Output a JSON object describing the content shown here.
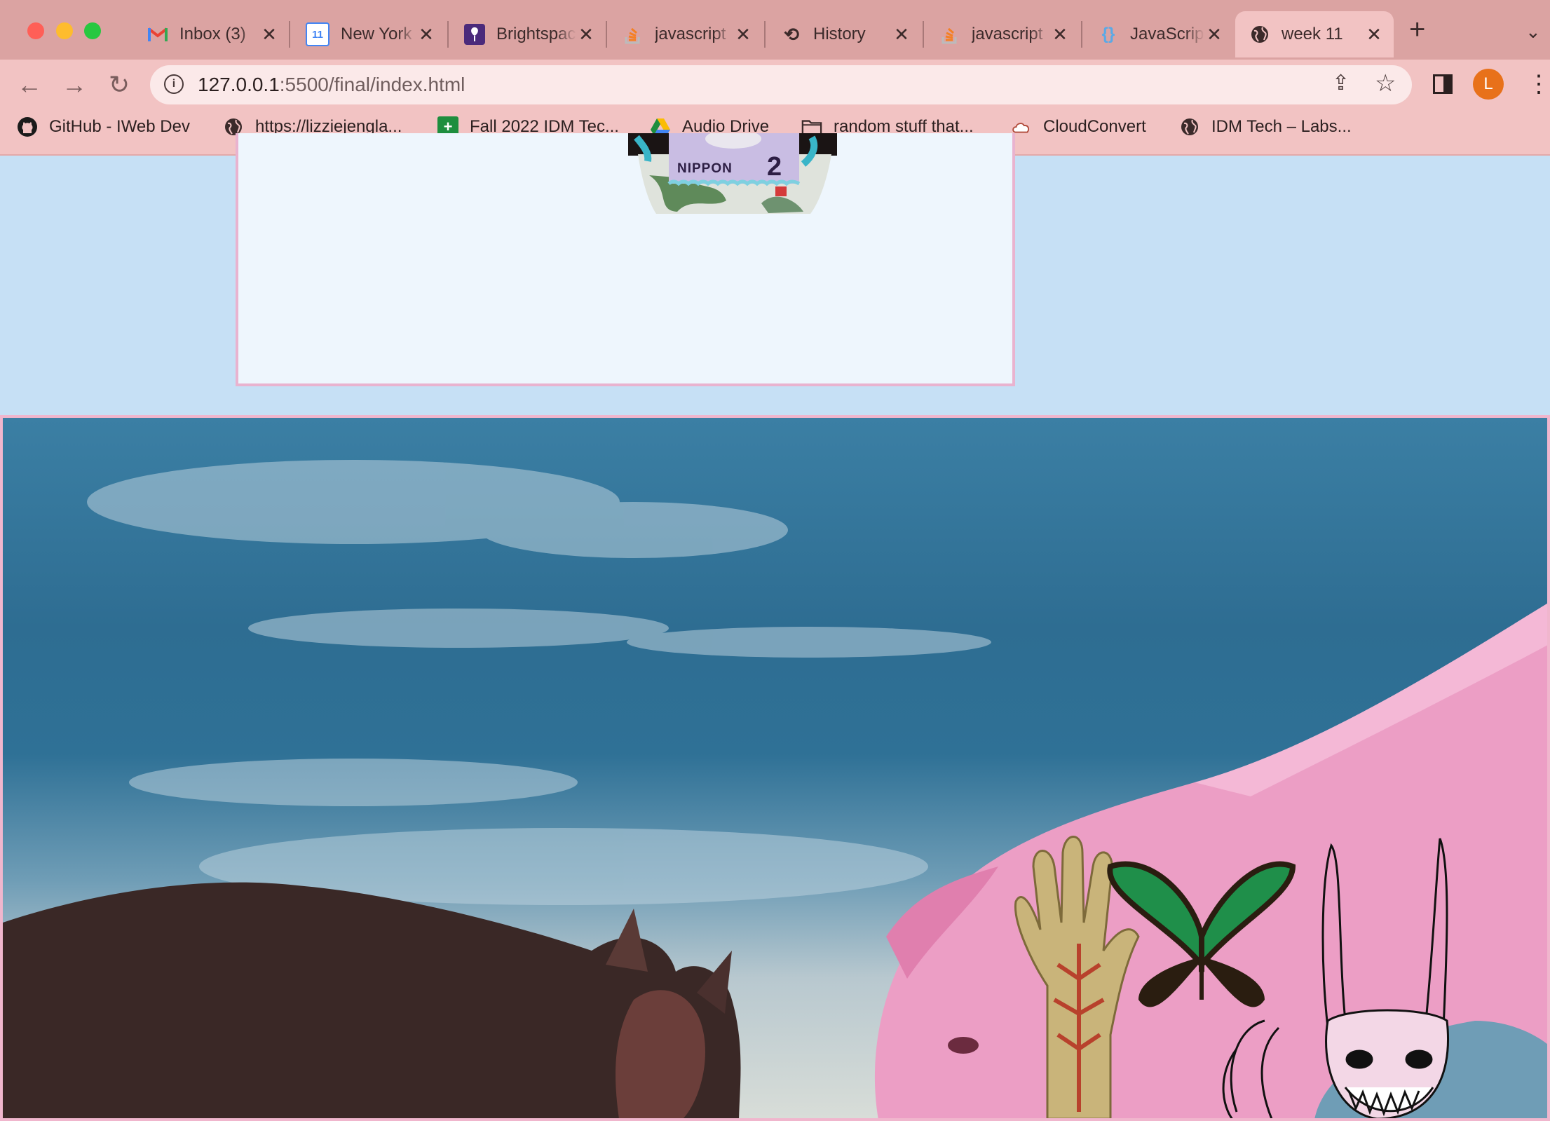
{
  "browser": {
    "tabs": [
      {
        "label": "Inbox (3)",
        "favicon": "gmail-icon",
        "active": false
      },
      {
        "label": "New York",
        "favicon": "calendar-icon",
        "favicon_text": "11",
        "active": false
      },
      {
        "label": "Brightspace",
        "favicon": "brightspace-icon",
        "active": false
      },
      {
        "label": "javascript",
        "favicon": "stackoverflow-icon",
        "active": false
      },
      {
        "label": "History",
        "favicon": "history-icon",
        "active": false
      },
      {
        "label": "javascript",
        "favicon": "stackoverflow-icon",
        "active": false
      },
      {
        "label": "JavaScript",
        "favicon": "braces-icon",
        "active": false
      },
      {
        "label": "week 11",
        "favicon": "globe-icon",
        "active": true
      }
    ],
    "address": {
      "host": "127.0.0.1",
      "path": ":5500/final/index.html"
    },
    "profile_initial": "L",
    "bookmarks": [
      {
        "label": "GitHub - IWeb Dev",
        "icon": "github-icon"
      },
      {
        "label": "https://lizziejengla...",
        "icon": "globe-icon"
      },
      {
        "label": "Fall 2022 IDM Tec...",
        "icon": "sheets-plus-icon"
      },
      {
        "label": "Audio Drive",
        "icon": "google-drive-icon"
      },
      {
        "label": "random stuff that...",
        "icon": "folder-icon"
      },
      {
        "label": "CloudConvert",
        "icon": "cloud-icon"
      },
      {
        "label": "IDM Tech – Labs...",
        "icon": "globe-icon"
      }
    ]
  },
  "page": {
    "stamp": {
      "country": "NIPPON",
      "value": "2"
    }
  },
  "colors": {
    "chrome": "#f2c3c3",
    "tabstrip": "#dba3a2",
    "page_bg": "#c6e0f5",
    "card_bg": "#eef6fd",
    "card_border": "#e9b3cf",
    "hero_border": "#f0b6cd",
    "avatar": "#e8711a"
  }
}
